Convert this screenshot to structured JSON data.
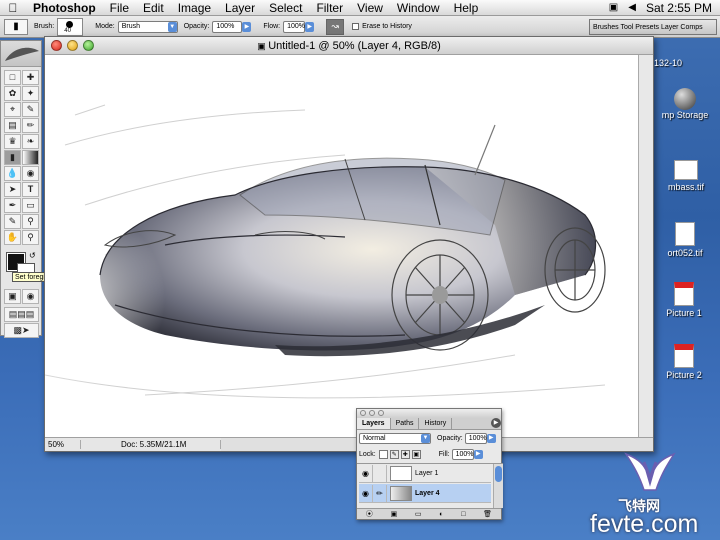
{
  "menubar": {
    "app_name": "Photoshop",
    "items": [
      "File",
      "Edit",
      "Image",
      "Layer",
      "Select",
      "Filter",
      "View",
      "Window",
      "Help"
    ],
    "clock": "Sat 2:55 PM",
    "icons": [
      "apple-icon",
      "display-icon",
      "volume-icon"
    ]
  },
  "options_bar": {
    "brush_label": "Brush:",
    "brush_size": "40",
    "mode_label": "Mode:",
    "mode_value": "Brush",
    "opacity_label": "Opacity:",
    "opacity_value": "100%",
    "flow_label": "Flow:",
    "flow_value": "100%",
    "erase_history_label": "Erase to History"
  },
  "palettes_well": {
    "label": "Brushes  Tool Presets  Layer Comps"
  },
  "document": {
    "title": "Untitled-1 @ 50% (Layer 4, RGB/8)",
    "zoom": "50%",
    "doc_info": "Doc: 5.35M/21.1M"
  },
  "toolbox": {
    "tooltip": "Set foreground color",
    "foreground_color": "#111111",
    "background_color": "#ffffff"
  },
  "desktop_icons": [
    {
      "label": "132-10"
    },
    {
      "label": "mp Storage"
    },
    {
      "label": "mbass.tif"
    },
    {
      "label": "ort052.tif"
    },
    {
      "label": "Picture 1"
    },
    {
      "label": "Picture 2"
    }
  ],
  "layers_panel": {
    "tabs": [
      "Layers",
      "Paths",
      "History"
    ],
    "blend_mode": "Normal",
    "opacity_label": "Opacity:",
    "opacity_value": "100%",
    "lock_label": "Lock:",
    "fill_label": "Fill:",
    "fill_value": "100%",
    "layers": [
      {
        "name": "Layer 1",
        "selected": false
      },
      {
        "name": "Layer 4",
        "selected": true
      }
    ]
  },
  "watermark": {
    "cn": "飞特网",
    "en": "fevte.com"
  },
  "colors": {
    "desktop": "#3a6db5",
    "selection": "#b7d0f2",
    "menu_accent": "#5a8ed8"
  }
}
